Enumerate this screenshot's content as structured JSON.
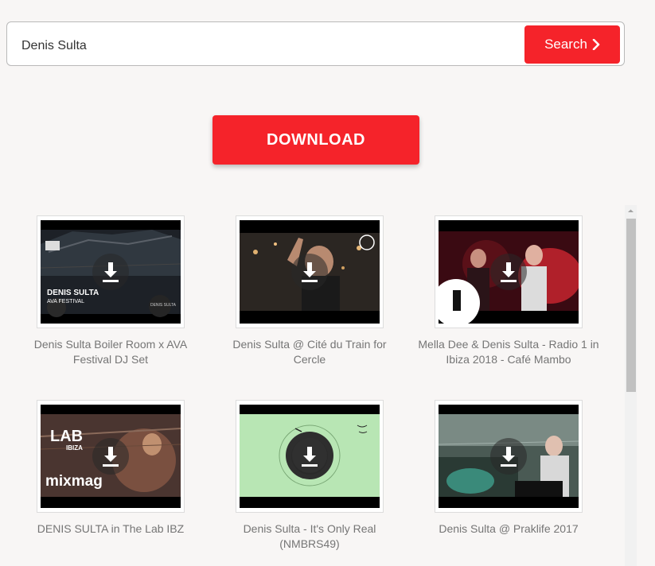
{
  "search": {
    "value": "Denis Sulta",
    "button_label": "Search",
    "button_icon": "chevron-right-icon"
  },
  "download": {
    "label": "DOWNLOAD"
  },
  "colors": {
    "accent": "#f5232a",
    "title_text": "#757575",
    "background": "#f8f6f5"
  },
  "results": [
    {
      "title": "Denis Sulta Boiler Room x AVA Festival DJ Set",
      "thumb_text": [
        "DENIS SULTA",
        "AVA FESTIVAL",
        "DENIS SULTA"
      ]
    },
    {
      "title": "Denis Sulta @ Cité du Train for Cercle",
      "thumb_text": []
    },
    {
      "title": "Mella Dee & Denis Sulta - Radio 1 in Ibiza 2018 - Café Mambo",
      "thumb_text": []
    },
    {
      "title": "DENIS SULTA in The Lab IBZ",
      "thumb_text": [
        "LAB",
        "IBIZA",
        "mixmag"
      ]
    },
    {
      "title": "Denis Sulta - It's Only Real (NMBRS49)",
      "thumb_text": []
    },
    {
      "title": "Denis Sulta @ Praklife 2017",
      "thumb_text": []
    }
  ]
}
